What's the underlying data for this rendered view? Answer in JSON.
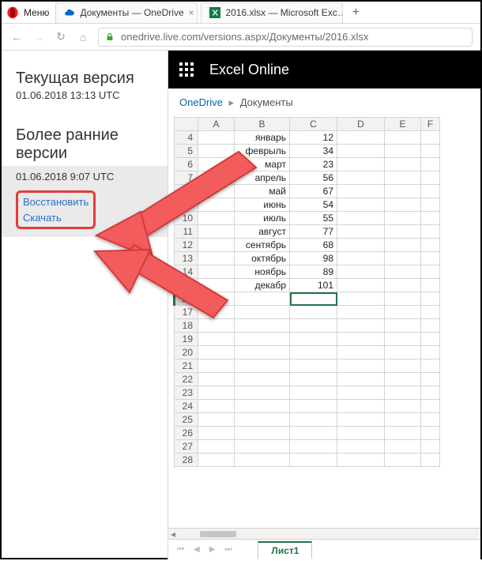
{
  "browser": {
    "menu_label": "Меню",
    "tabs": [
      {
        "label": "Документы — OneDrive"
      },
      {
        "label": "2016.xlsx — Microsoft Exc…"
      }
    ],
    "url": "onedrive.live.com/versions.aspx/Документы/2016.xlsx"
  },
  "sidebar": {
    "current_heading": "Текущая версия",
    "current_time": "01.06.2018 13:13 UTC",
    "older_heading": "Более ранние версии",
    "older_time": "01.06.2018 9:07 UTC",
    "restore_label": "Восстановить",
    "download_label": "Скачать"
  },
  "excel": {
    "title": "Excel Online",
    "crumb_root": "OneDrive",
    "crumb_folder": "Документы",
    "columns": [
      "A",
      "B",
      "C",
      "D",
      "E",
      "F"
    ],
    "active_col": "C",
    "active_row": 16,
    "row_start": 4,
    "row_end": 28,
    "data": {
      "4": {
        "B": "январь",
        "C": 12
      },
      "5": {
        "B": "феврыль",
        "C": 34
      },
      "6": {
        "B": "март",
        "C": 23
      },
      "7": {
        "B": "апрель",
        "C": 56
      },
      "8": {
        "B": "май",
        "C": 67
      },
      "9": {
        "B": "июнь",
        "C": 54
      },
      "10": {
        "B": "июль",
        "C": 55
      },
      "11": {
        "B": "август",
        "C": 77
      },
      "12": {
        "B": "сентябрь",
        "C": 68
      },
      "13": {
        "B": "октябрь",
        "C": 98
      },
      "14": {
        "B": "ноябрь",
        "C": 89
      },
      "15": {
        "B": "декабр",
        "C": 101
      }
    },
    "sheet_tab": "Лист1"
  },
  "colors": {
    "accent": "#217346",
    "arrow": "#f35b5b"
  }
}
